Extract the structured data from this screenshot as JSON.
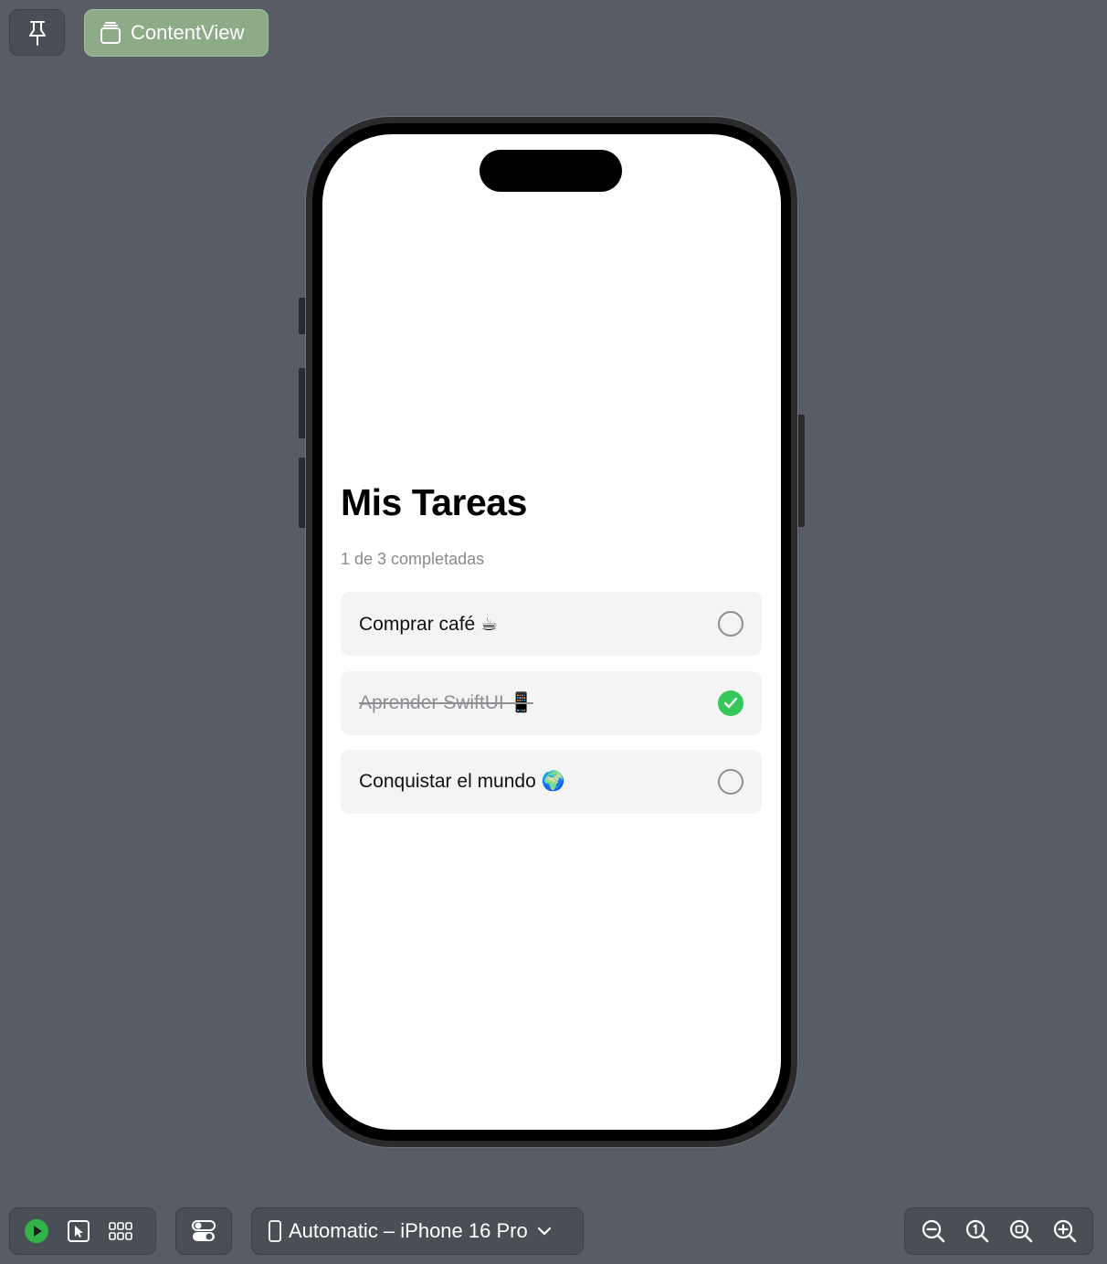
{
  "header": {
    "preview_name": "ContentView"
  },
  "app": {
    "title": "Mis Tareas",
    "summary": "1 de 3 completadas",
    "tasks": [
      {
        "label": "Comprar café ☕",
        "completed": false
      },
      {
        "label": "Aprender SwiftUI 📱",
        "completed": true
      },
      {
        "label": "Conquistar el mundo 🌍",
        "completed": false
      }
    ]
  },
  "toolbar": {
    "device": "Automatic – iPhone 16 Pro"
  },
  "icons": {
    "pin": "pin-icon",
    "preview": "stack-icon",
    "play": "play-icon",
    "select": "cursor-icon",
    "variants": "grid-icon",
    "settings": "toggles-icon",
    "device": "iphone-icon",
    "chevron": "chevron-down-icon",
    "zoom_out": "zoom-out-icon",
    "zoom_actual": "zoom-actual-icon",
    "zoom_fit": "zoom-fit-icon",
    "zoom_in": "zoom-in-icon"
  },
  "colors": {
    "background": "#585d65",
    "preview_chip": "#8cab86",
    "check_green": "#34c759",
    "play_green": "#30b34a"
  }
}
